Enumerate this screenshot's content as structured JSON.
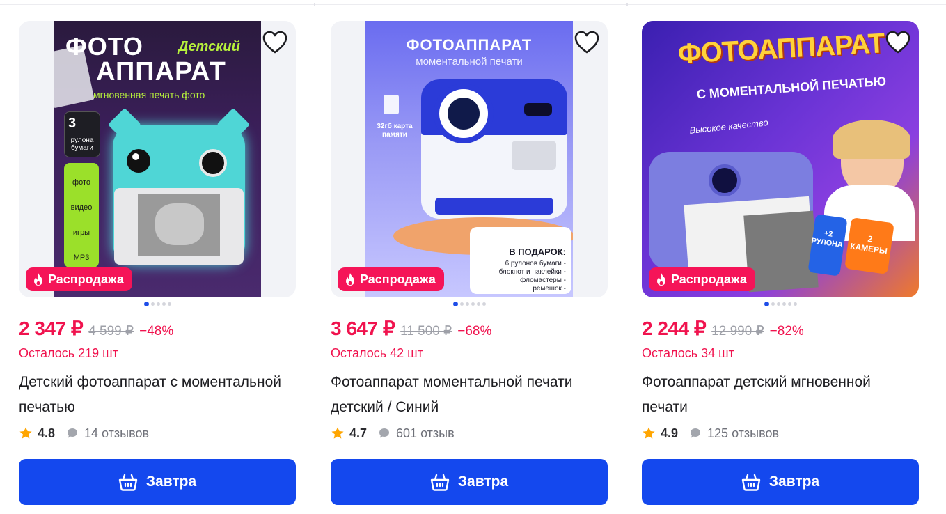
{
  "products": [
    {
      "badge": "Распродажа",
      "price": "2 347 ₽",
      "old_price": "4 599 ₽",
      "discount": "−48%",
      "stock": "Осталось 219 шт",
      "title": "Детский фотоаппарат с моментальной печатью",
      "rating": "4.8",
      "reviews": "14 отзывов",
      "cta": "Завтра",
      "art": {
        "line1": "ФОТО",
        "line1b": "Детский",
        "line2": "АППАРАТ",
        "line3": "мгновенная печать фото",
        "rolls_num": "3",
        "rolls_text": "рулона бумаги",
        "features": [
          "фото",
          "видео",
          "игры",
          "MP3"
        ]
      }
    },
    {
      "badge": "Распродажа",
      "price": "3 647 ₽",
      "old_price": "11 500 ₽",
      "discount": "−68%",
      "stock": "Осталось 42 шт",
      "title": "Фотоаппарат моментальной печати детский / Синий",
      "rating": "4.7",
      "reviews": "601 отзыв",
      "cta": "Завтра",
      "art": {
        "line1": "ФОТОАППАРАТ",
        "line2": "моментальной печати",
        "memory": "32гб карта памяти",
        "gift_title": "В ПОДАРОК:",
        "gift_items": [
          "6 рулонов бумаги -",
          "блокнот и наклейки -",
          "фломастеры -",
          "ремешок -"
        ]
      }
    },
    {
      "badge": "Распродажа",
      "price": "2 244 ₽",
      "old_price": "12 990 ₽",
      "discount": "−82%",
      "stock": "Осталось 34 шт",
      "title": "Фотоаппарат детский мгновенной печати",
      "rating": "4.9",
      "reviews": "125 отзывов",
      "cta": "Завтра",
      "art": {
        "line1": "ФОТОАППАРАТ",
        "line2": "С МОМЕНТАЛЬНОЙ ПЕЧАТЬЮ",
        "quality": "Высокое качество",
        "sticker1": "+2 РУЛОНА",
        "sticker2": "2 КАМЕРЫ"
      }
    }
  ],
  "colors": {
    "accent": "#1448ee",
    "sale": "#f51458",
    "price": "#f0134e",
    "star": "#ffa500"
  }
}
